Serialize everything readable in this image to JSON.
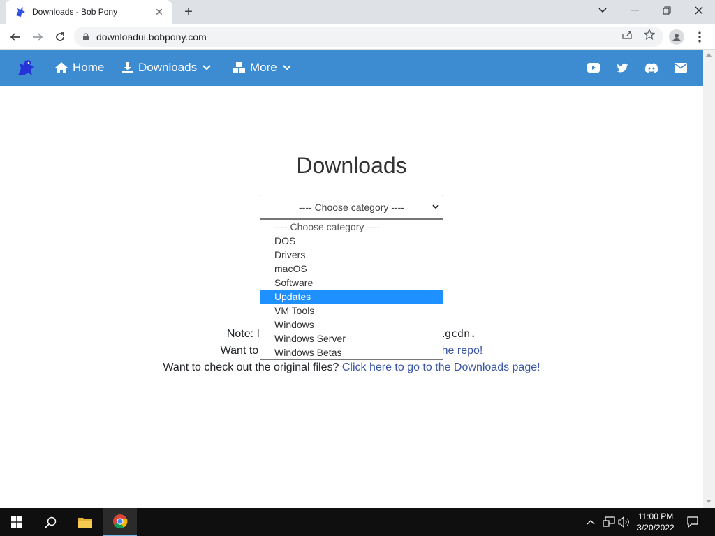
{
  "browser": {
    "tab_title": "Downloads - Bob Pony",
    "url": "downloadui.bobpony.com"
  },
  "nav": {
    "home": "Home",
    "downloads": "Downloads",
    "more": "More"
  },
  "page": {
    "title": "Downloads",
    "select_value": "---- Choose category ----",
    "options": [
      "---- Choose category ----",
      "DOS",
      "Drivers",
      "macOS",
      "Software",
      "Updates",
      "VM Tools",
      "Windows",
      "Windows Server",
      "Windows Betas"
    ],
    "highlighted_option": "Updates",
    "note_prefix": "Note: I",
    "note_suffix": "igcdn.",
    "repo_prefix": "Want to",
    "repo_link": "the repo!",
    "original_prefix": "Want to check out the original files?",
    "original_link": "Click here to go to the Downloads page!"
  },
  "taskbar": {
    "time": "11:00 PM",
    "date": "3/20/2022"
  },
  "colors": {
    "nav_bar": "#3d8bd0",
    "highlight": "#1e90ff",
    "link": "#3a57a6"
  }
}
